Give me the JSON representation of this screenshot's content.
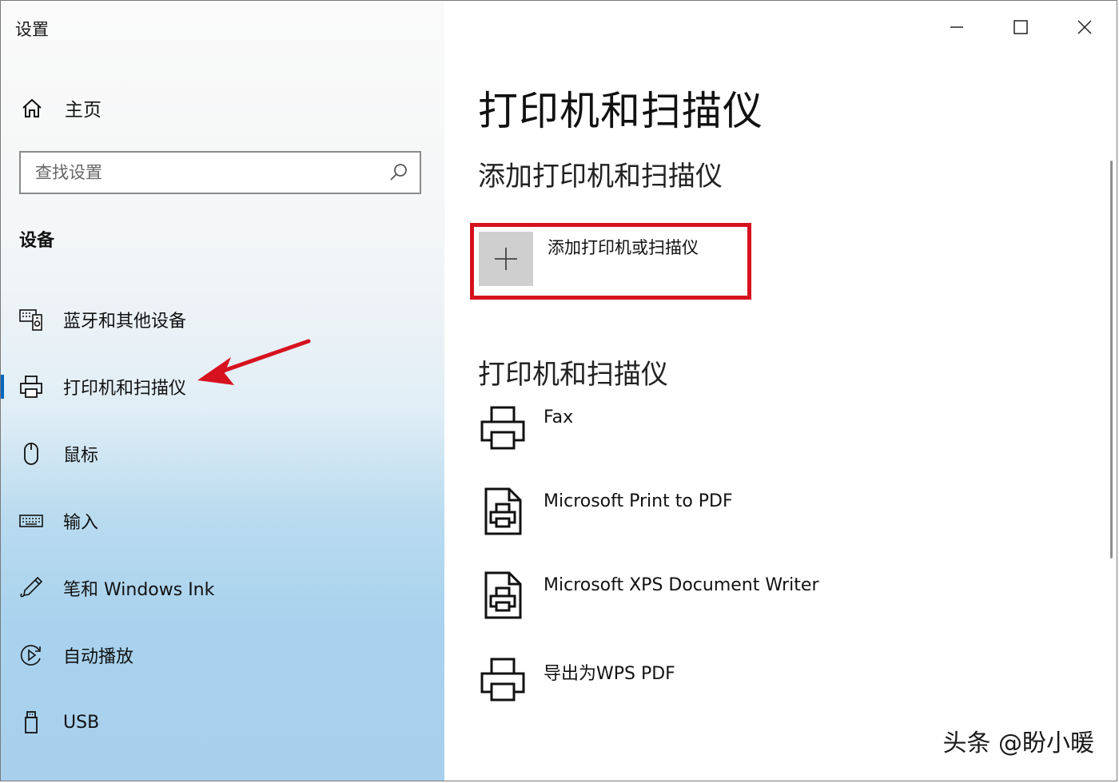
{
  "window": {
    "title": "设置"
  },
  "sidebar": {
    "home_label": "主页",
    "search": {
      "placeholder": "查找设置",
      "value": ""
    },
    "section_title": "设备",
    "items": [
      {
        "label": "蓝牙和其他设备",
        "icon": "bluetooth-devices-icon",
        "active": false
      },
      {
        "label": "打印机和扫描仪",
        "icon": "printer-icon",
        "active": true
      },
      {
        "label": "鼠标",
        "icon": "mouse-icon",
        "active": false
      },
      {
        "label": "输入",
        "icon": "keyboard-icon",
        "active": false
      },
      {
        "label": "笔和 Windows Ink",
        "icon": "pen-icon",
        "active": false
      },
      {
        "label": "自动播放",
        "icon": "autoplay-icon",
        "active": false
      },
      {
        "label": "USB",
        "icon": "usb-icon",
        "active": false
      }
    ]
  },
  "main": {
    "page_title": "打印机和扫描仪",
    "add_section_title": "添加打印机和扫描仪",
    "add_button_label": "添加打印机或扫描仪",
    "list_title": "打印机和扫描仪",
    "printers": [
      {
        "name": "Fax",
        "icon": "printer-icon"
      },
      {
        "name": "Microsoft Print to PDF",
        "icon": "pdf-printer-icon"
      },
      {
        "name": "Microsoft XPS Document Writer",
        "icon": "pdf-printer-icon"
      },
      {
        "name": "导出为WPS PDF",
        "icon": "printer-icon"
      }
    ]
  },
  "watermark": "头条 @盼小暖",
  "colors": {
    "highlight": "#d6121f",
    "accent": "#0067c0",
    "arrow": "#d6121f"
  }
}
